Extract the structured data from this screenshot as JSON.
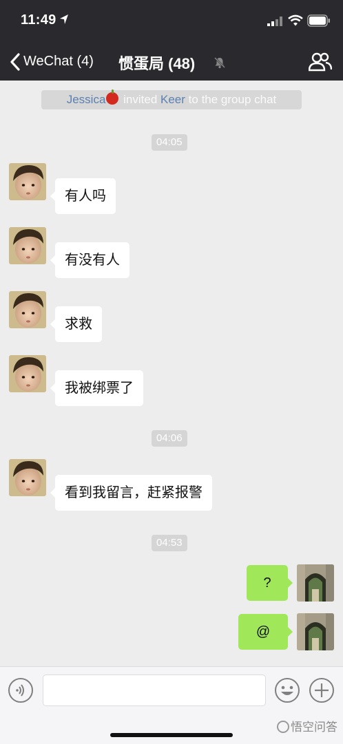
{
  "status_bar": {
    "time": "11:49"
  },
  "nav": {
    "back_label": "WeChat (4)",
    "title": "惯蛋局 (48)"
  },
  "system_notice": {
    "inviter": "Jessica",
    "text": "invited",
    "invitee": "Keer",
    "suffix": "to the group chat"
  },
  "timestamps": [
    "04:05",
    "04:06",
    "04:53"
  ],
  "messages": [
    {
      "sender": "other",
      "text": "有人吗"
    },
    {
      "sender": "other",
      "text": "有没有人"
    },
    {
      "sender": "other",
      "text": "求救"
    },
    {
      "sender": "other",
      "text": "我被绑票了"
    },
    {
      "sender": "other",
      "text": "看到我留言，赶紧报警"
    },
    {
      "sender": "me",
      "text": "?"
    },
    {
      "sender": "me",
      "text": "@"
    }
  ],
  "watermark": "悟空问答",
  "colors": {
    "header": "#2a2a2e",
    "background": "#ededed",
    "my_bubble": "#a0e75a",
    "other_bubble": "#ffffff",
    "link_name": "#5b7fb0"
  },
  "icons": [
    "location-arrow-icon",
    "signal-icon",
    "wifi-icon",
    "battery-icon",
    "back-chevron-icon",
    "mute-bell-icon",
    "group-members-icon",
    "voice-icon",
    "emoji-icon",
    "plus-icon"
  ]
}
